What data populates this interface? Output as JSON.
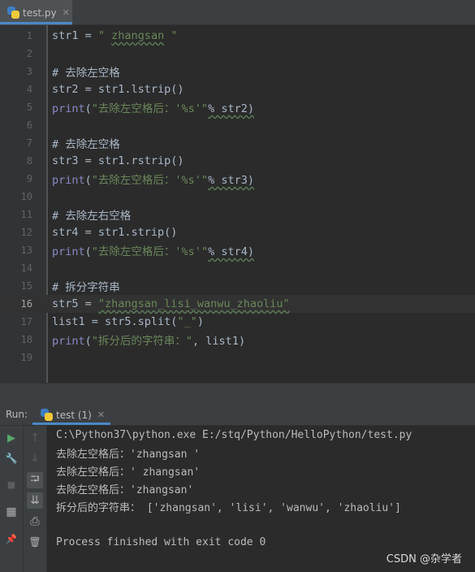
{
  "editor_tab": {
    "title": "test.py",
    "close": "✕"
  },
  "code_lines": [
    {
      "num": "1"
    },
    {
      "num": "2"
    },
    {
      "num": "3"
    },
    {
      "num": "4"
    },
    {
      "num": "5"
    },
    {
      "num": "6"
    },
    {
      "num": "7"
    },
    {
      "num": "8"
    },
    {
      "num": "9"
    },
    {
      "num": "10"
    },
    {
      "num": "11"
    },
    {
      "num": "12"
    },
    {
      "num": "13"
    },
    {
      "num": "14"
    },
    {
      "num": "15"
    },
    {
      "num": "16"
    },
    {
      "num": "17"
    },
    {
      "num": "18"
    },
    {
      "num": "19"
    }
  ],
  "code": {
    "l1_a": "str1 = ",
    "l1_b": "\" ",
    "l1_c": "zhangsan",
    "l1_d": " \"",
    "l3": "# 去除左空格",
    "l4": "str2 = str1.lstrip()",
    "l5_fn": "print",
    "l5_a": "(",
    "l5_str": "\"去除左空格后：'%s'\"",
    "l5_b": "% str2)",
    "l7": "# 去除左空格",
    "l8": "str3 = str1.rstrip()",
    "l9_fn": "print",
    "l9_a": "(",
    "l9_str": "\"去除左空格后：'%s'\"",
    "l9_b": "% str3)",
    "l11": "# 去除左右空格",
    "l12": "str4 = str1.strip()",
    "l13_fn": "print",
    "l13_a": "(",
    "l13_str": "\"去除左空格后：'%s'\"",
    "l13_b": "% str4)",
    "l15": "# 拆分字符串",
    "l16_a": "str5 = ",
    "l16_str": "\"zhangsan_lisi_wanwu_zhaoliu\"",
    "l17_a": "list1 = str5.split(",
    "l17_str": "\"_\"",
    "l17_b": ")",
    "l18_fn": "print",
    "l18_a": "(",
    "l18_str": "\"拆分后的字符串：\"",
    "l18_b": ", list1)"
  },
  "run_panel": {
    "label": "Run:",
    "tab_title": "test (1)",
    "tab_close": "✕"
  },
  "console_lines": [
    "C:\\Python37\\python.exe E:/stq/Python/HelloPython/test.py",
    "去除左空格后：'zhangsan '",
    "去除左空格后：' zhangsan'",
    "去除左空格后：'zhangsan'",
    "拆分后的字符串： ['zhangsan', 'lisi', 'wanwu', 'zhaoliu']",
    "",
    "Process finished with exit code 0"
  ],
  "watermark": "CSDN @杂学者",
  "icons": {
    "rerun": "▶",
    "wrench": "🔧",
    "stop": "■",
    "layout": "▦",
    "pin": "📌",
    "up": "↑",
    "down": "↓",
    "soft_wrap": "⮒",
    "scroll_end": "⇊",
    "print": "⎙",
    "trash": "🗑"
  }
}
